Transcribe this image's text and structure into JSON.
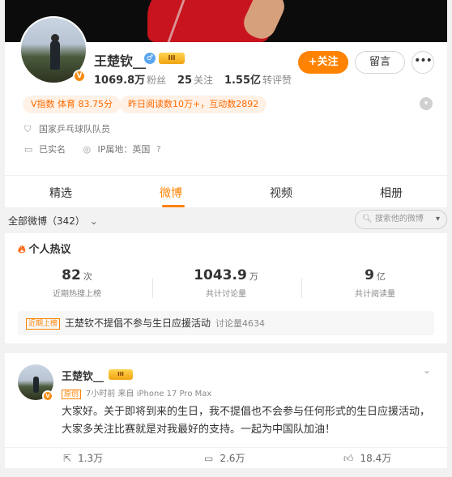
{
  "profile": {
    "name": "王楚钦__",
    "level": "III",
    "verified_mark": "V",
    "followers": "1069.8万",
    "followers_label": "粉丝",
    "following": "25",
    "following_label": "关注",
    "reposts": "1.55亿",
    "reposts_label": "转评赞",
    "follow_button": "+关注",
    "message_button": "留言",
    "more_button": "•••",
    "tags": [
      "V指数 体育 83.75分",
      "昨日阅读数10万+，互动数2892"
    ],
    "identity": "国家乒乓球队队员",
    "realname": "已实名",
    "ip": "IP属地：英国",
    "colors": {
      "accent": "#ff8200",
      "tag_bg": "#fff1e6"
    }
  },
  "tabs": [
    "精选",
    "微博",
    "视频",
    "相册"
  ],
  "active_tab": "微博",
  "filter": {
    "label": "全部微博（342）",
    "search_placeholder": "搜索他的微博"
  },
  "hot": {
    "title": "个人热议",
    "metrics": [
      {
        "num": "82",
        "unit": "次",
        "label": "近期热搜上榜"
      },
      {
        "num": "1043.9",
        "unit": "万",
        "label": "共计讨论量"
      },
      {
        "num": "9",
        "unit": "亿",
        "label": "共计阅读量"
      }
    ],
    "topic_badge": "近期上榜",
    "topic": "王楚钦不提倡不参与生日应援活动",
    "topic_count": "讨论量4634"
  },
  "post": {
    "author": "王楚钦__",
    "level": "III",
    "badge": "原创",
    "meta": "7小时前  来自 iPhone 17 Pro Max",
    "text": "大家好。关于即将到来的生日，我不提倡也不会参与任何形式的生日应援活动，大家多关注比赛就是对我最好的支持。一起为中国队加油！",
    "reposts": "1.3万",
    "comments": "2.6万",
    "likes": "18.4万"
  }
}
